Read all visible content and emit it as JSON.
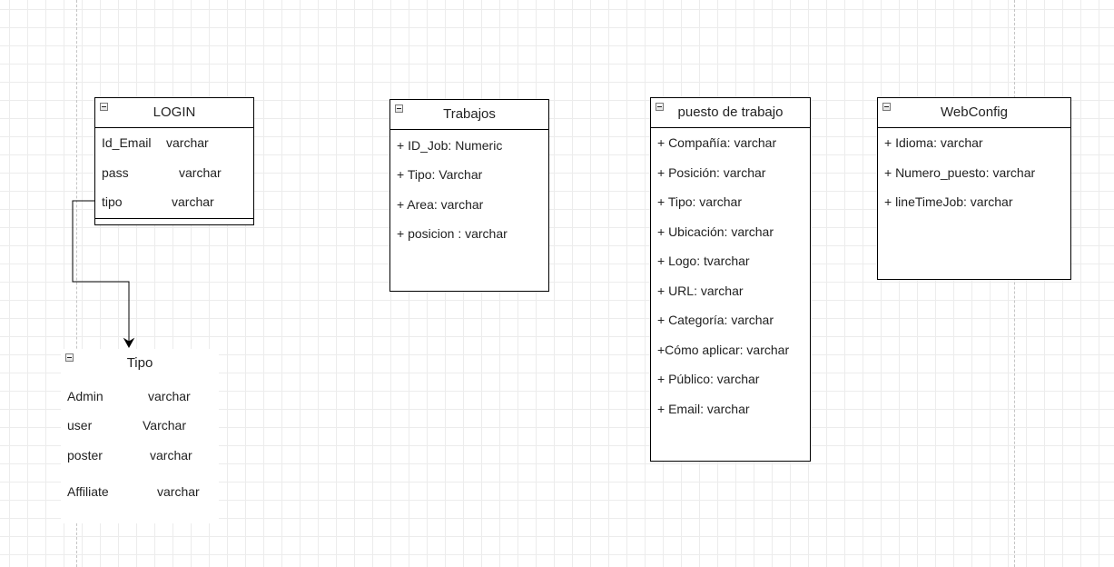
{
  "entities": {
    "login": {
      "title": "LOGIN",
      "rows": [
        {
          "name": "Id_Email",
          "type": "varchar"
        },
        {
          "name": "pass",
          "type": "varchar"
        },
        {
          "name": "tipo",
          "type": "varchar"
        }
      ]
    },
    "trabajos": {
      "title": "Trabajos",
      "attributes": [
        "+ ID_Job: Numeric",
        "+ Tipo: Varchar",
        "+ Area: varchar",
        "+ posicion : varchar"
      ]
    },
    "puesto": {
      "title": "puesto de trabajo",
      "attributes": [
        "+ Compañía: varchar",
        "+ Posición: varchar",
        "+ Tipo: varchar",
        "+ Ubicación: varchar",
        "+ Logo: tvarchar",
        "+ URL: varchar",
        "+ Categoría: varchar",
        "+Cómo aplicar: varchar",
        "+ Público: varchar",
        "+ Email: varchar"
      ]
    },
    "webconfig": {
      "title": "WebConfig",
      "attributes": [
        "+ Idioma: varchar",
        "+ Numero_puesto: varchar",
        "+ lineTimeJob: varchar"
      ]
    },
    "tipo": {
      "title": "Tipo",
      "rows": [
        {
          "name": "Admin",
          "type": "varchar"
        },
        {
          "name": "user",
          "type": "Varchar"
        },
        {
          "name": "poster",
          "type": "varchar"
        },
        {
          "name": "Affiliate",
          "type": "varchar"
        }
      ]
    }
  },
  "relationships": [
    {
      "from": "LOGIN.tipo",
      "to": "Tipo"
    }
  ]
}
